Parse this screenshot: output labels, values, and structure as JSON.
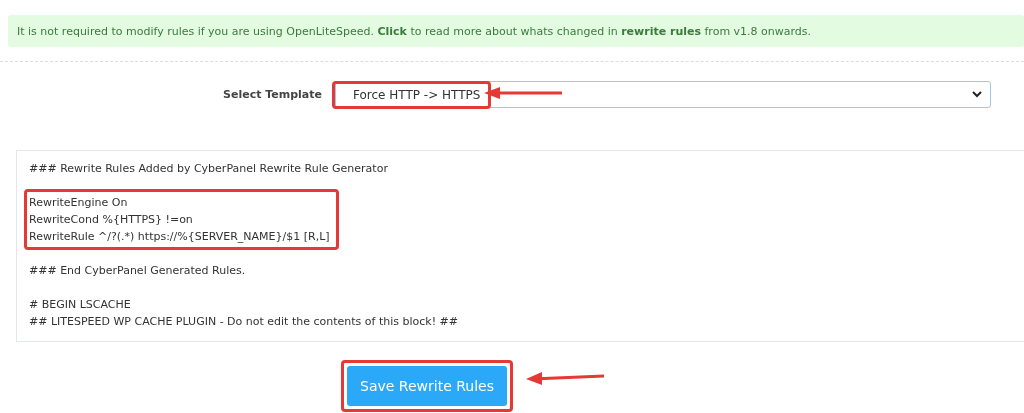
{
  "notice": "It is not required to modify rules if you are using OpenLiteSpeed. **Click** to read more about whats changed in **rewrite rules** from v1.8 onwards.",
  "template": {
    "label": "Select Template",
    "value": "Force HTTP -> HTTPS",
    "highlighted": true
  },
  "editor": {
    "blocks": [
      {
        "lines": [
          "### Rewrite Rules Added by CyberPanel Rewrite Rule Generator"
        ],
        "highlighted": false
      },
      {
        "lines": [
          "RewriteEngine On",
          "RewriteCond %{HTTPS}  !=on",
          "RewriteRule ^/?(.*) https://%{SERVER_NAME}/$1 [R,L]"
        ],
        "highlighted": true
      },
      {
        "lines": [
          "### End CyberPanel Generated Rules."
        ],
        "highlighted": false
      },
      {
        "lines": [
          "# BEGIN LSCACHE",
          "## LITESPEED WP CACHE PLUGIN - Do not edit the contents of this block! ##"
        ],
        "highlighted": false
      }
    ]
  },
  "save_button": {
    "label": "Save Rewrite Rules",
    "highlighted": true
  }
}
